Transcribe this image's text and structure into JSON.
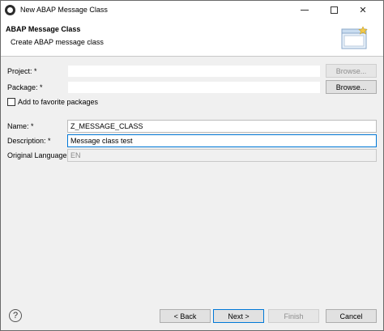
{
  "window": {
    "title": "New ABAP Message Class"
  },
  "banner": {
    "heading": "ABAP Message Class",
    "subheading": "Create ABAP message class"
  },
  "form": {
    "project": {
      "label": "Project: *",
      "value": "",
      "browse_label": "Browse...",
      "browse_enabled": false
    },
    "package": {
      "label": "Package: *",
      "value": "",
      "browse_label": "Browse...",
      "browse_enabled": true
    },
    "favorite": {
      "label": "Add to favorite packages",
      "checked": false
    },
    "name": {
      "label": "Name: *",
      "value": "Z_MESSAGE_CLASS"
    },
    "description": {
      "label": "Description: *",
      "value": "Message class test"
    },
    "original_language": {
      "label": "Original Language:",
      "value": "EN"
    }
  },
  "footer": {
    "help_glyph": "?",
    "back_label": "< Back",
    "next_label": "Next >",
    "finish_label": "Finish",
    "cancel_label": "Cancel"
  },
  "icons": [
    "app-icon",
    "minimize-icon",
    "maximize-icon",
    "close-icon",
    "wizard-banner-icon",
    "help-icon"
  ]
}
